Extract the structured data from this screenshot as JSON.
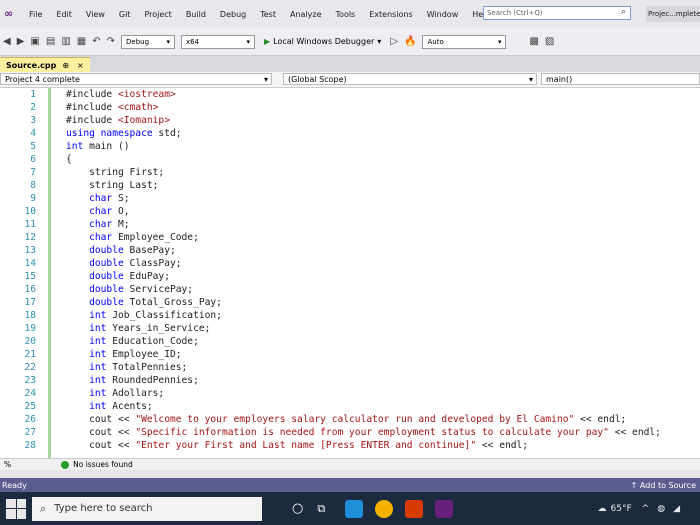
{
  "menubar": {
    "items": [
      "File",
      "Edit",
      "View",
      "Git",
      "Project",
      "Build",
      "Debug",
      "Test",
      "Analyze",
      "Tools",
      "Extensions",
      "Window",
      "Help"
    ],
    "search_placeholder": "Search (Ctrl+Q)",
    "project_name": "Projec...mplete"
  },
  "toolbar": {
    "config": "Debug",
    "platform": "x64",
    "run_label": "Local Windows Debugger",
    "auto_label": "Auto"
  },
  "tab": {
    "label": "Source.cpp",
    "pin": "⊕",
    "close": "×"
  },
  "navbar": {
    "project": "Project 4 complete",
    "scope": "(Global Scope)",
    "member": "main()"
  },
  "code_lines": [
    {
      "n": "1",
      "parts": [
        {
          "t": "#include ",
          "c": ""
        },
        {
          "t": "<iostream>",
          "c": "str"
        }
      ]
    },
    {
      "n": "2",
      "parts": [
        {
          "t": "#include ",
          "c": ""
        },
        {
          "t": "<cmath>",
          "c": "str"
        }
      ]
    },
    {
      "n": "3",
      "parts": [
        {
          "t": "#include ",
          "c": ""
        },
        {
          "t": "<Iomanip>",
          "c": "str"
        }
      ]
    },
    {
      "n": "4",
      "parts": [
        {
          "t": "using namespace ",
          "c": "kw"
        },
        {
          "t": "std;",
          "c": ""
        }
      ]
    },
    {
      "n": "5",
      "parts": [
        {
          "t": "int ",
          "c": "kw"
        },
        {
          "t": "main ()",
          "c": ""
        }
      ]
    },
    {
      "n": "6",
      "parts": [
        {
          "t": "{",
          "c": ""
        }
      ]
    },
    {
      "n": "7",
      "parts": [
        {
          "t": "    string First;",
          "c": ""
        }
      ]
    },
    {
      "n": "8",
      "parts": [
        {
          "t": "    string Last;",
          "c": ""
        }
      ]
    },
    {
      "n": "9",
      "parts": [
        {
          "t": "    char ",
          "c": "kw"
        },
        {
          "t": "S;",
          "c": ""
        }
      ]
    },
    {
      "n": "10",
      "parts": [
        {
          "t": "    char ",
          "c": "kw"
        },
        {
          "t": "O,",
          "c": ""
        }
      ]
    },
    {
      "n": "11",
      "parts": [
        {
          "t": "    char ",
          "c": "kw"
        },
        {
          "t": "M;",
          "c": ""
        }
      ]
    },
    {
      "n": "12",
      "parts": [
        {
          "t": "    char ",
          "c": "kw"
        },
        {
          "t": "Employee_Code;",
          "c": ""
        }
      ]
    },
    {
      "n": "13",
      "parts": [
        {
          "t": "    double ",
          "c": "kw"
        },
        {
          "t": "BasePay;",
          "c": ""
        }
      ]
    },
    {
      "n": "14",
      "parts": [
        {
          "t": "    double ",
          "c": "kw"
        },
        {
          "t": "ClassPay;",
          "c": ""
        }
      ]
    },
    {
      "n": "15",
      "parts": [
        {
          "t": "    double ",
          "c": "kw"
        },
        {
          "t": "EduPay;",
          "c": ""
        }
      ]
    },
    {
      "n": "16",
      "parts": [
        {
          "t": "    double ",
          "c": "kw"
        },
        {
          "t": "ServicePay;",
          "c": ""
        }
      ]
    },
    {
      "n": "17",
      "parts": [
        {
          "t": "    double ",
          "c": "kw"
        },
        {
          "t": "Total_Gross_Pay;",
          "c": ""
        }
      ]
    },
    {
      "n": "18",
      "parts": [
        {
          "t": "    int ",
          "c": "kw"
        },
        {
          "t": "Job_Classification;",
          "c": ""
        }
      ]
    },
    {
      "n": "19",
      "parts": [
        {
          "t": "    int ",
          "c": "kw"
        },
        {
          "t": "Years_in_Service;",
          "c": ""
        }
      ]
    },
    {
      "n": "20",
      "parts": [
        {
          "t": "    int ",
          "c": "kw"
        },
        {
          "t": "Education_Code;",
          "c": ""
        }
      ]
    },
    {
      "n": "21",
      "parts": [
        {
          "t": "    int ",
          "c": "kw"
        },
        {
          "t": "Employee_ID;",
          "c": ""
        }
      ]
    },
    {
      "n": "22",
      "parts": [
        {
          "t": "    int ",
          "c": "kw"
        },
        {
          "t": "TotalPennies;",
          "c": ""
        }
      ]
    },
    {
      "n": "23",
      "parts": [
        {
          "t": "    int ",
          "c": "kw"
        },
        {
          "t": "RoundedPennies;",
          "c": ""
        }
      ]
    },
    {
      "n": "24",
      "parts": [
        {
          "t": "    int ",
          "c": "kw"
        },
        {
          "t": "Adollars;",
          "c": ""
        }
      ]
    },
    {
      "n": "25",
      "parts": [
        {
          "t": "    int ",
          "c": "kw"
        },
        {
          "t": "Acents;",
          "c": ""
        }
      ]
    },
    {
      "n": "26",
      "parts": [
        {
          "t": "    cout << ",
          "c": ""
        },
        {
          "t": "\"Welcome to your employers salary calculator run and developed by El Camino\"",
          "c": "str"
        },
        {
          "t": " << endl;",
          "c": ""
        }
      ]
    },
    {
      "n": "27",
      "parts": [
        {
          "t": "    cout << ",
          "c": ""
        },
        {
          "t": "\"Specific information is needed from your employment status to calculate your pay\"",
          "c": "str"
        },
        {
          "t": " << endl;",
          "c": ""
        }
      ]
    },
    {
      "n": "28",
      "parts": [
        {
          "t": "    cout << ",
          "c": ""
        },
        {
          "t": "\"Enter your First and Last name [Press ENTER and continue]\"",
          "c": "str"
        },
        {
          "t": " << endl;",
          "c": ""
        }
      ]
    }
  ],
  "editor_status": {
    "zoom": "%",
    "message": "No issues found"
  },
  "statusbar": {
    "left": "Ready",
    "right": "Add to Source"
  },
  "taskbar": {
    "search_placeholder": "Type here to search",
    "temperature": "65°F"
  }
}
